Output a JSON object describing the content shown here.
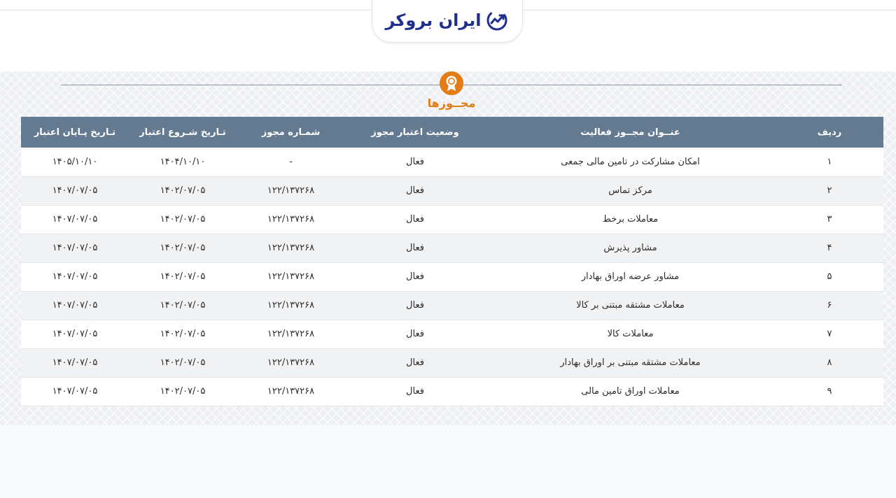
{
  "header": {
    "logo_text": "ایران بروکر",
    "logo_icon": "chart-growth-icon"
  },
  "section": {
    "title": "مجــوزها",
    "badge_icon": "award-ribbon-icon",
    "accent_color": "#e27c15"
  },
  "table": {
    "header_color": "#647a90",
    "columns": [
      "ردیف",
      "عنــوان مجــوز فعالیت",
      "وضعیت اعتبار مجوز",
      "شمـاره مجوز",
      "تـاریخ شـروع اعتبار",
      "تـاریخ پـایان اعتبار"
    ],
    "rows": [
      [
        "۱",
        "امکان مشارکت در تامین مالی جمعی",
        "فعال",
        "-",
        "۱۴۰۴/۱۰/۱۰",
        "۱۴۰۵/۱۰/۱۰"
      ],
      [
        "۲",
        "مرکز تماس",
        "فعال",
        "۱۲۲/۱۳۷۲۶۸",
        "۱۴۰۲/۰۷/۰۵",
        "۱۴۰۷/۰۷/۰۵"
      ],
      [
        "۳",
        "معاملات برخط",
        "فعال",
        "۱۲۲/۱۳۷۲۶۸",
        "۱۴۰۲/۰۷/۰۵",
        "۱۴۰۷/۰۷/۰۵"
      ],
      [
        "۴",
        "مشاور پذیرش",
        "فعال",
        "۱۲۲/۱۳۷۲۶۸",
        "۱۴۰۲/۰۷/۰۵",
        "۱۴۰۷/۰۷/۰۵"
      ],
      [
        "۵",
        "مشاور عرضه اوراق بهادار",
        "فعال",
        "۱۲۲/۱۳۷۲۶۸",
        "۱۴۰۲/۰۷/۰۵",
        "۱۴۰۷/۰۷/۰۵"
      ],
      [
        "۶",
        "معاملات مشتقه مبتنی بر کالا",
        "فعال",
        "۱۲۲/۱۳۷۲۶۸",
        "۱۴۰۲/۰۷/۰۵",
        "۱۴۰۷/۰۷/۰۵"
      ],
      [
        "۷",
        "معاملات کالا",
        "فعال",
        "۱۲۲/۱۳۷۲۶۸",
        "۱۴۰۲/۰۷/۰۵",
        "۱۴۰۷/۰۷/۰۵"
      ],
      [
        "۸",
        "معاملات مشتقه مبتنی بر اوراق بهادار",
        "فعال",
        "۱۲۲/۱۳۷۲۶۸",
        "۱۴۰۲/۰۷/۰۵",
        "۱۴۰۷/۰۷/۰۵"
      ],
      [
        "۹",
        "معاملات اوراق تامین مالی",
        "فعال",
        "۱۲۲/۱۳۷۲۶۸",
        "۱۴۰۲/۰۷/۰۵",
        "۱۴۰۷/۰۷/۰۵"
      ]
    ]
  }
}
